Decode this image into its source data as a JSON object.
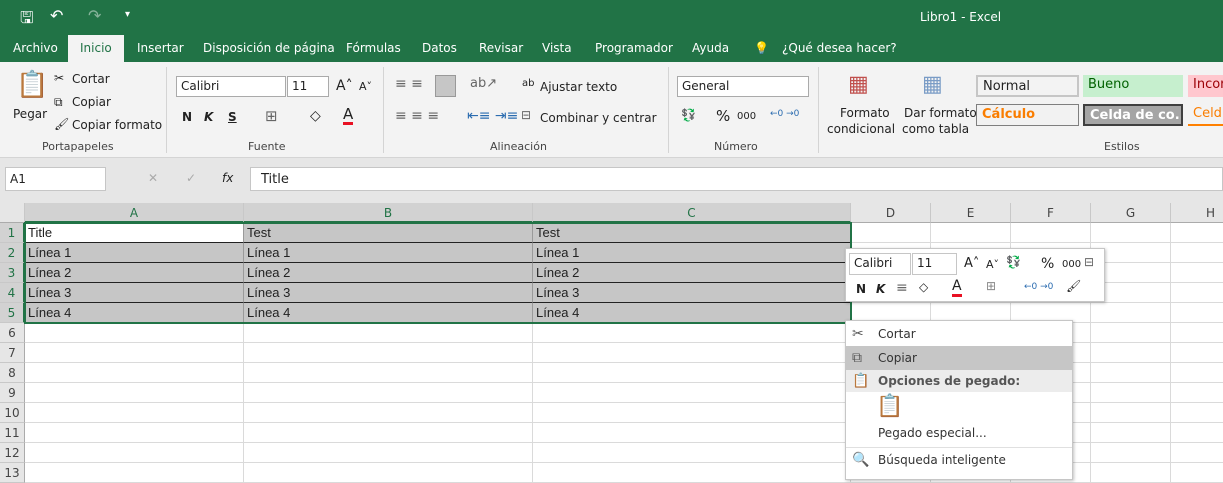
{
  "app": {
    "title": "Libro1  -  Excel",
    "brand_color": "#217346"
  },
  "qat": {
    "save_icon": "save-icon",
    "undo_icon": "undo-icon",
    "redo_icon": "redo-icon",
    "customize_icon": "customize-icon"
  },
  "tabs": [
    "Archivo",
    "Inicio",
    "Insertar",
    "Disposición de página",
    "Fórmulas",
    "Datos",
    "Revisar",
    "Vista",
    "Programador",
    "Ayuda"
  ],
  "active_tab": "Inicio",
  "tell_me": "¿Qué desea hacer?",
  "ribbon": {
    "clipboard": {
      "paste": "Pegar",
      "cut": "Cortar",
      "copy": "Copiar",
      "format_painter": "Copiar formato",
      "label": "Portapapeles"
    },
    "font": {
      "name": "Calibri",
      "size": "11",
      "bold": "N",
      "italic": "K",
      "underline": "S",
      "label": "Fuente",
      "font_color": "#e81123"
    },
    "alignment": {
      "wrap": "Ajustar texto",
      "merge": "Combinar y centrar",
      "label": "Alineación"
    },
    "number": {
      "format": "General",
      "percent": "%",
      "thousands": "000",
      "label": "Número"
    },
    "styles": {
      "conditional": [
        "Formato",
        "condicional"
      ],
      "as_table": [
        "Dar formato",
        "como tabla"
      ],
      "label": "Estilos",
      "cells": [
        {
          "name": "Normal",
          "bg": "#ffffff",
          "fg": "#000000"
        },
        {
          "name": "Bueno",
          "bg": "#c6efce",
          "fg": "#006100"
        },
        {
          "name": "Incor",
          "bg": "#ffc7ce",
          "fg": "#9c0006"
        },
        {
          "name": "Cálculo",
          "bg": "#f2f2f2",
          "fg": "#fa7d00"
        },
        {
          "name": "Celda de co...",
          "bg": "#a5a5a5",
          "fg": "#ffffff"
        },
        {
          "name": "Celd",
          "bg": "#ffffff",
          "fg": "#fa7d00"
        }
      ]
    }
  },
  "formula_bar": {
    "name_box": "A1",
    "fx": "fx",
    "value": "Title"
  },
  "columns": [
    "A",
    "B",
    "C",
    "D",
    "E",
    "F",
    "G",
    "H"
  ],
  "rows": [
    "1",
    "2",
    "3",
    "4",
    "5",
    "6",
    "7",
    "8",
    "9",
    "10",
    "11",
    "12",
    "13"
  ],
  "cells": [
    [
      "Title",
      "Test",
      "Test"
    ],
    [
      "Línea 1",
      "Línea 1",
      "Línea 1"
    ],
    [
      "Línea 2",
      "Línea 2",
      "Línea 2"
    ],
    [
      "Línea 3",
      "Línea 3",
      "Línea 3"
    ],
    [
      "Línea 4",
      "Línea 4",
      "Línea 4"
    ]
  ],
  "mini_toolbar": {
    "font": "Calibri",
    "size": "11",
    "percent": "%",
    "thousands": "000",
    "bold": "N",
    "italic": "K"
  },
  "context_menu": {
    "cut": "Cortar",
    "copy": "Copiar",
    "paste_options": "Opciones de pegado:",
    "paste_special": "Pegado especial...",
    "smart_lookup": "Búsqueda inteligente"
  }
}
